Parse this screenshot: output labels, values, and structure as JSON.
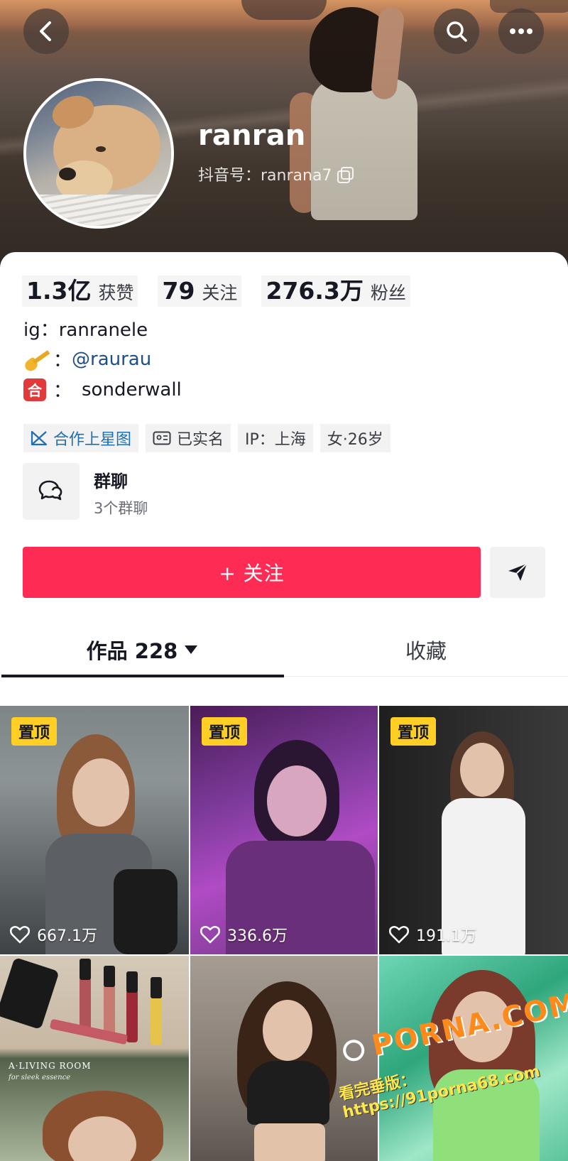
{
  "header": {
    "username": "ranran",
    "douyin_id": "抖音号：ranrana7"
  },
  "stats": [
    {
      "value": "1.3亿",
      "label": "获赞"
    },
    {
      "value": "79",
      "label": "关注"
    },
    {
      "value": "276.3万",
      "label": "粉丝"
    }
  ],
  "bio": {
    "line1": "ig：ranranele",
    "line2_sep": "：",
    "line2_mention": "@raurau",
    "line3_sep": "：",
    "line3_text": "sonderwall",
    "line3_emoji": "合"
  },
  "tags": [
    {
      "label": "合作上星图",
      "icon": "star-map-icon"
    },
    {
      "label": "已实名",
      "icon": "id-card-icon"
    },
    {
      "label": "IP：上海"
    },
    {
      "label": "女·26岁"
    }
  ],
  "group_chat": {
    "title": "群聊",
    "subtitle": "3个群聊"
  },
  "actions": {
    "follow_label": "+ 关注"
  },
  "tabs": {
    "works_label": "作品 228",
    "collect_label": "收藏"
  },
  "videos": [
    {
      "pinned": true,
      "pin_label": "置顶",
      "likes": "667.1万"
    },
    {
      "pinned": true,
      "pin_label": "置顶",
      "likes": "336.6万"
    },
    {
      "pinned": true,
      "pin_label": "置顶",
      "likes": "191.1万"
    },
    {
      "pinned": false
    },
    {
      "pinned": false
    },
    {
      "pinned": false
    }
  ],
  "poster_text": {
    "line1": "A·LIVING ROOM",
    "line2": "for sleek essence"
  },
  "watermark": {
    "brand": "PORNA.COM",
    "line": "看完垂版：https://91porna68.com"
  },
  "colors": {
    "accent": "#fe2c55",
    "pin": "#ffcf26",
    "mention": "#1f4f8a"
  }
}
